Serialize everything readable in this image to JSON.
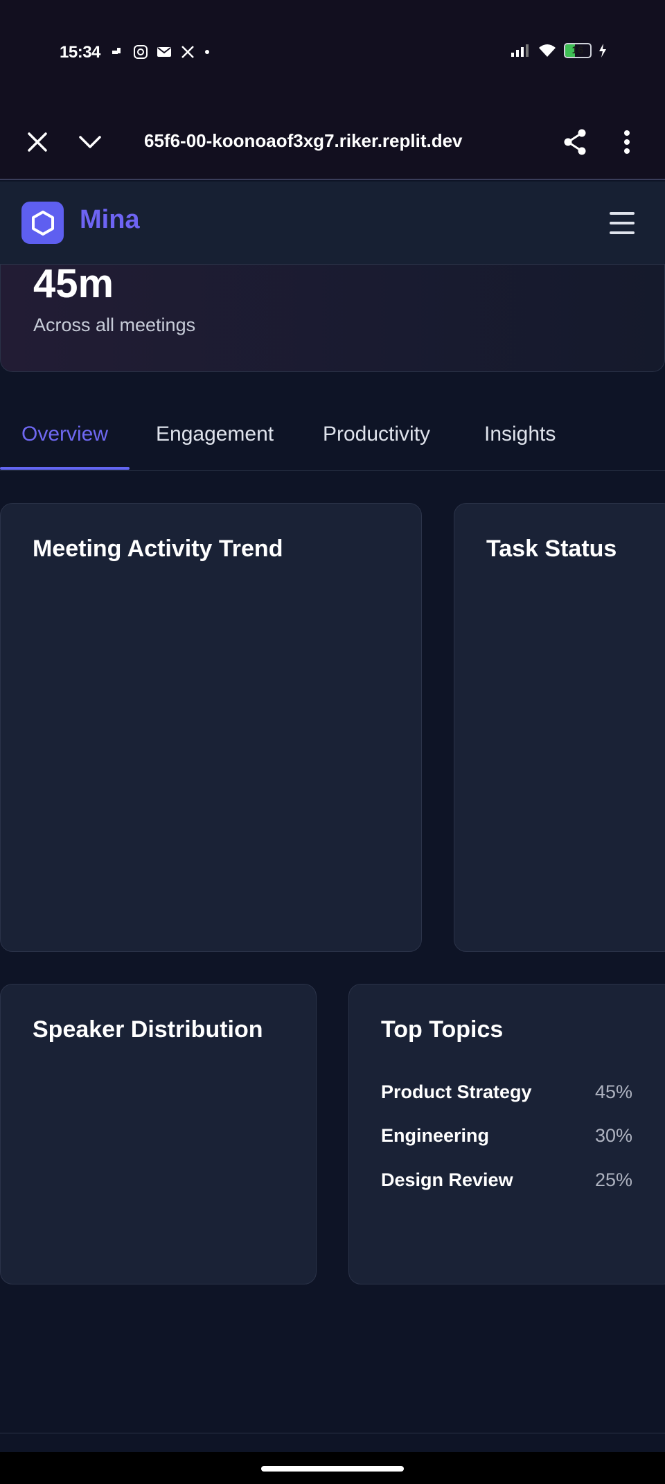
{
  "status_bar": {
    "time": "15:34",
    "battery": "16"
  },
  "browser": {
    "url": "65f6-00-koonoaof3xg7.riker.replit.dev"
  },
  "app": {
    "name": "Mina"
  },
  "stat": {
    "value": "45m",
    "label": "Across all meetings"
  },
  "tabs": [
    {
      "label": "Overview",
      "active": true
    },
    {
      "label": "Engagement"
    },
    {
      "label": "Productivity"
    },
    {
      "label": "Insights"
    }
  ],
  "cards": {
    "activity_trend": {
      "title": "Meeting Activity Trend"
    },
    "task_status": {
      "title": "Task Status"
    },
    "speaker_distribution": {
      "title": "Speaker Distribution"
    },
    "top_topics": {
      "title": "Top Topics",
      "items": [
        {
          "name": "Product Strategy",
          "percent": "45%"
        },
        {
          "name": "Engineering",
          "percent": "30%"
        },
        {
          "name": "Design Review",
          "percent": "25%"
        }
      ]
    }
  },
  "colors": {
    "accent": "#6366f1",
    "background": "#0e1426",
    "card": "#1a2236"
  }
}
